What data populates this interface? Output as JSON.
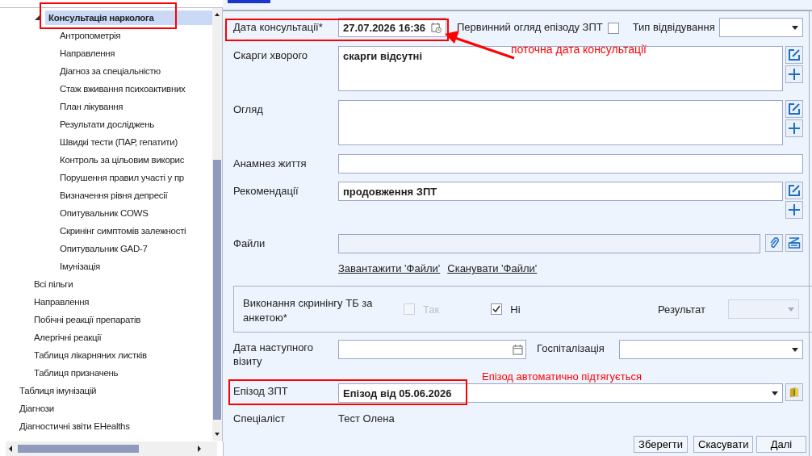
{
  "tree": {
    "items": [
      {
        "children": [
          {
            "label": "Консультація нарколога",
            "selected": true,
            "expanded": true,
            "children": [
              {
                "label": "Антропометрія",
                "selected": false
              },
              {
                "label": "Направлення",
                "selected": false
              },
              {
                "label": "Діагноз за спеціальністю",
                "selected": false
              },
              {
                "label": "Стаж вживання психоактивних",
                "selected": false
              },
              {
                "label": "План лікування",
                "selected": false
              },
              {
                "label": "Результати досліджень",
                "selected": false
              },
              {
                "label": "Швидкі тести (ПАР, гепатити)",
                "selected": false
              },
              {
                "label": "Контроль за цільовим викорис",
                "selected": false
              },
              {
                "label": "Порушення правил участі у пр",
                "selected": false
              },
              {
                "label": "Визначення рівня депресії",
                "selected": false
              },
              {
                "label": "Опитувальник COWS",
                "selected": false
              },
              {
                "label": "Скринінг симптомів залежності",
                "selected": false
              },
              {
                "label": "Опитувальник GAD-7",
                "selected": false
              },
              {
                "label": "Імунізація",
                "selected": false
              }
            ]
          },
          {
            "label": "Всі пільги",
            "selected": false
          },
          {
            "label": "Направлення",
            "selected": false
          },
          {
            "label": "Побічні реакції препаратів",
            "selected": false
          },
          {
            "label": "Алергічні реакції",
            "selected": false
          },
          {
            "label": "Таблиця лікарняних листків",
            "selected": false
          },
          {
            "label": "Таблиця призначень",
            "selected": false
          }
        ]
      },
      {
        "label": "Таблиця імунізацій",
        "selected": false
      },
      {
        "label": "Діагнози",
        "selected": false
      },
      {
        "label": "Діагностичні звіти EHealths",
        "selected": false
      }
    ]
  },
  "form": {
    "consultation_date": {
      "label": "Дата консультації*",
      "value": "27.07.2026 16:36"
    },
    "primary_review": {
      "label": "Первинний огляд епізоду ЗПТ",
      "checked": false
    },
    "visit_type": {
      "label": "Тип відвідування"
    },
    "complaints": {
      "label": "Скарги хворого",
      "value": "скарги відсутні"
    },
    "examination": {
      "label": "Огляд"
    },
    "life_anamnesis": {
      "label": "Анамнез життя"
    },
    "recommendations": {
      "label": "Рекомендації",
      "value": "продовження ЗПТ"
    },
    "files": {
      "label": "Файли",
      "links": [
        "Завантажити 'Файли'",
        "Сканувати 'Файли'"
      ]
    },
    "tb_screening": {
      "label": "Виконання скринінгу ТБ за анкетою*",
      "options": [
        {
          "label": "Так",
          "checked": false,
          "disabled": true
        },
        {
          "label": "Ні",
          "checked": true,
          "disabled": false
        }
      ],
      "result_label": "Результат",
      "result_disabled": true
    },
    "next_visit": {
      "label": "Дата наступного візиту"
    },
    "hospitalization": {
      "label": "Госпіталізація"
    },
    "episode": {
      "label": "Епізод ЗПТ",
      "value": "Епізод від 05.06.2026"
    },
    "specialist": {
      "label": "Спеціаліст",
      "value": "Тест Олена"
    }
  },
  "buttons": [
    "Зберегти",
    "Скасувати",
    "Далі"
  ],
  "annotations": [
    {
      "text": "поточна дата консультації"
    },
    {
      "text": "Епізод автоматично підтягується"
    }
  ]
}
